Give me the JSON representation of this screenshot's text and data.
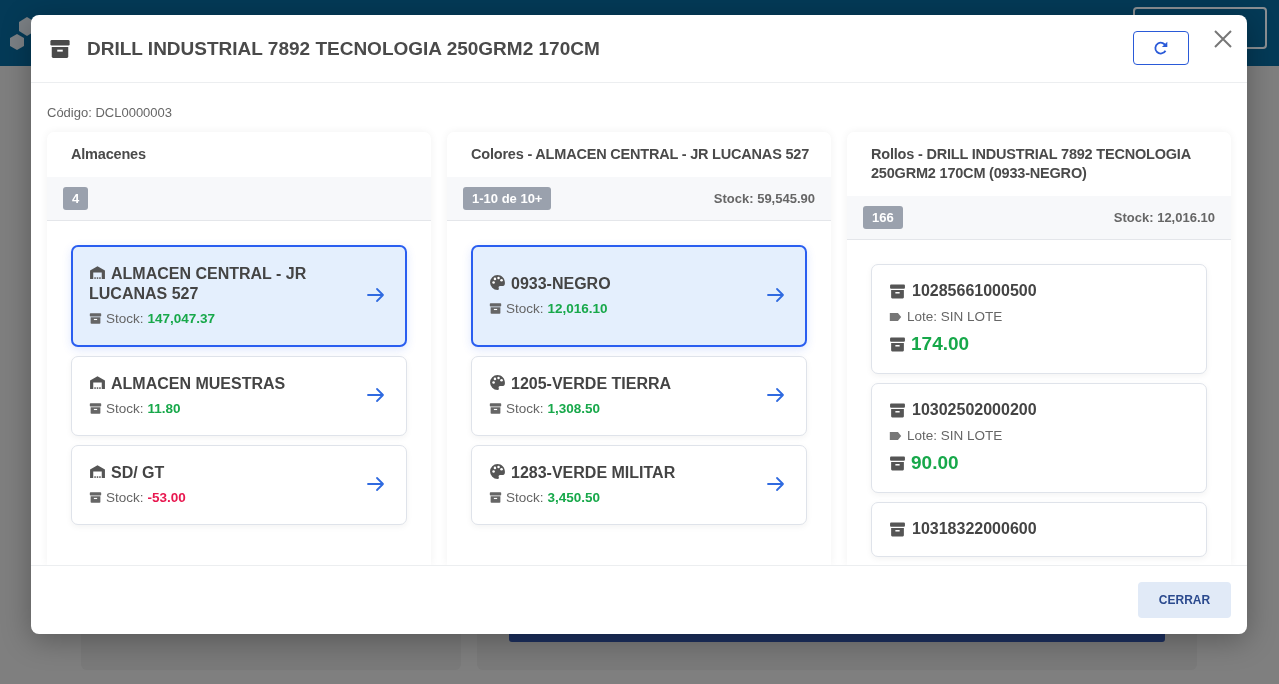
{
  "dialog": {
    "title": "DRILL INDUSTRIAL 7892 TECNOLOGIA 250GRM2 170CM",
    "code": "Código: DCL0000003",
    "footer_button": "CERRAR"
  },
  "columns": [
    {
      "kind": "warehouses",
      "title": "Almacenes",
      "badge": "4",
      "items": [
        {
          "name": "ALMACEN CENTRAL - JR LUCANAS 527",
          "stock_label": "Stock:",
          "stock": "147,047.37",
          "color": "#17a84a",
          "selected": true
        },
        {
          "name": "ALMACEN MUESTRAS",
          "stock_label": "Stock:",
          "stock": "11.80",
          "color": "#17a84a",
          "selected": false
        },
        {
          "name": "SD/ GT",
          "stock_label": "Stock:",
          "stock": "-53.00",
          "color": "#e8174f",
          "selected": false
        }
      ]
    },
    {
      "kind": "colors",
      "title": "Colores - ALMACEN CENTRAL - JR LUCANAS 527",
      "badge": "1-10 de 10+",
      "total": "Stock: 59,545.90",
      "items": [
        {
          "name": "0933-NEGRO",
          "stock_label": "Stock:",
          "stock": "12,016.10",
          "color": "#17a84a",
          "selected": true
        },
        {
          "name": "1205-VERDE TIERRA",
          "stock_label": "Stock:",
          "stock": "1,308.50",
          "color": "#17a84a",
          "selected": false
        },
        {
          "name": "1283-VERDE MILITAR",
          "stock_label": "Stock:",
          "stock": "3,450.50",
          "color": "#17a84a",
          "selected": false
        }
      ]
    },
    {
      "kind": "rolls",
      "title": "Rollos - DRILL INDUSTRIAL 7892 TECNOLOGIA 250GRM2 170CM (0933-NEGRO)",
      "badge": "166",
      "total": "Stock: 12,016.10",
      "items": [
        {
          "code": "10285661000500",
          "lot": "Lote: SIN LOTE",
          "quantity": "174.00"
        },
        {
          "code": "10302502000200",
          "lot": "Lote: SIN LOTE",
          "quantity": "90.00"
        },
        {
          "code": "10318322000600"
        }
      ]
    }
  ]
}
